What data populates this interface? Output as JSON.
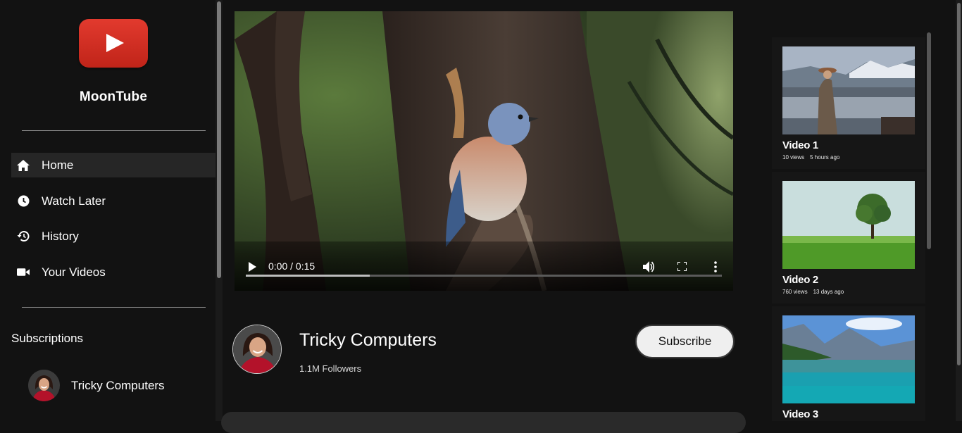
{
  "app": {
    "name": "MoonTube",
    "brand_color": "#d32a20"
  },
  "sidebar": {
    "nav": [
      {
        "label": "Home",
        "icon": "home-icon",
        "active": true
      },
      {
        "label": "Watch Later",
        "icon": "clock-icon",
        "active": false
      },
      {
        "label": "History",
        "icon": "history-icon",
        "active": false
      },
      {
        "label": "Your Videos",
        "icon": "video-camera-icon",
        "active": false
      }
    ],
    "subscriptions_title": "Subscriptions",
    "subscriptions": [
      {
        "name": "Tricky Computers"
      }
    ]
  },
  "player": {
    "time": "0:00 / 0:15",
    "progress_fraction": 0.26,
    "controls": [
      "play-icon",
      "volume-icon",
      "fullscreen-icon",
      "more-vert-icon"
    ]
  },
  "channel": {
    "name": "Tricky Computers",
    "followers": "1.1M Followers",
    "subscribe_label": "Subscribe"
  },
  "recommended": [
    {
      "title": "Video 1",
      "views": "10 views",
      "age": "5 hours ago"
    },
    {
      "title": "Video 2",
      "views": "760 views",
      "age": "13 days ago"
    },
    {
      "title": "Video 3",
      "views": "",
      "age": ""
    }
  ]
}
